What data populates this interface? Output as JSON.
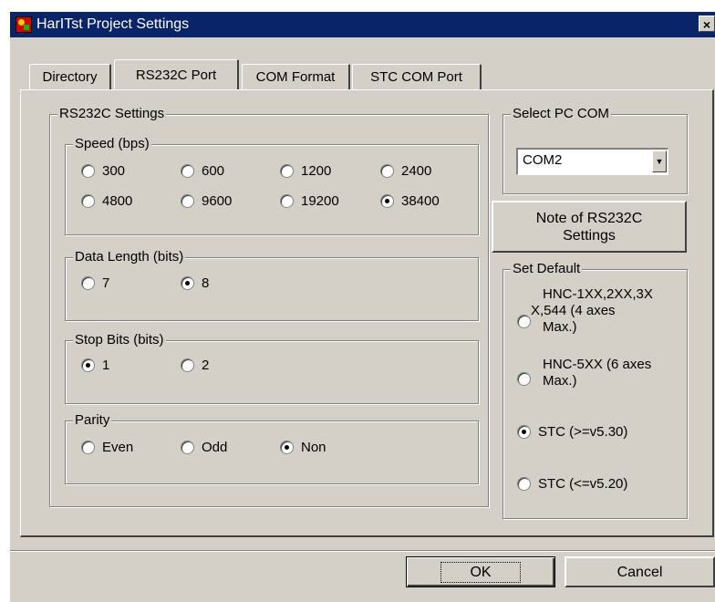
{
  "window": {
    "title": "HarITst Project Settings",
    "close_glyph": "×",
    "app_icon": "harness-app-icon"
  },
  "tabs": [
    {
      "label": "Directory"
    },
    {
      "label": "RS232C Port",
      "active": true
    },
    {
      "label": "COM Format"
    },
    {
      "label": "STC COM Port"
    }
  ],
  "rs232c": {
    "label": "RS232C Settings",
    "speed": {
      "label": "Speed (bps)",
      "options": [
        "300",
        "600",
        "1200",
        "2400",
        "4800",
        "9600",
        "19200",
        "38400"
      ],
      "selected": "38400"
    },
    "data_length": {
      "label": "Data Length (bits)",
      "options": [
        "7",
        "8"
      ],
      "selected": "8"
    },
    "stop_bits": {
      "label": "Stop Bits (bits)",
      "options": [
        "1",
        "2"
      ],
      "selected": "1"
    },
    "parity": {
      "label": "Parity",
      "options": [
        "Even",
        "Odd",
        "Non"
      ],
      "selected": "Non"
    }
  },
  "pc_com": {
    "label": "Select PC COM",
    "value": "COM2",
    "dropdown_icon": "▼"
  },
  "note_button": {
    "label_line1": "Note of RS232C",
    "label_line2": "Settings"
  },
  "set_default": {
    "label": "Set Default",
    "options": [
      {
        "line1": "HNC-1XX,2XX,3X",
        "line2": "X,544 (4 axes",
        "line3": "Max.)"
      },
      {
        "line1": "HNC-5XX (6 axes",
        "line2": "Max.)"
      },
      {
        "line1": "STC (>=v5.30)"
      },
      {
        "line1": "STC (<=v5.20)"
      }
    ],
    "selected_index": 2
  },
  "buttons": {
    "ok": "OK",
    "cancel": "Cancel"
  },
  "colors": {
    "face": "#d4d0c8",
    "titlebar": "#0a246a"
  }
}
